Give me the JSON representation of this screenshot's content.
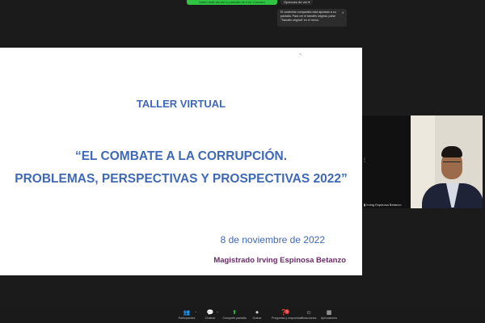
{
  "banner": {
    "share_text": "Usted está viendo la pantalla de Irvin Corrarra",
    "view_options": "Opciones de ver ▾"
  },
  "tooltip": {
    "line1": "El contenido compartido está ajustado a su",
    "line2": "pantalla. Para ver el tamaño original, pulse",
    "line3": "\"Tamaño original\" en el menú.",
    "close": "✕"
  },
  "slide": {
    "title": "TALLER VIRTUAL",
    "subtitle_line1": "“EL COMBATE A LA CORRUPCIÓN.",
    "subtitle_line2": "PROBLEMAS, PERSPECTIVAS Y PROSPECTIVAS 2022”",
    "date": "8 de noviembre de 2022",
    "author": "Magistrado Irving Espinosa Betanzo"
  },
  "participant": {
    "name": "Irving Espinosa Betanzo",
    "grip_icon": "⋮"
  },
  "toolbar": {
    "items": [
      {
        "icon": "people-icon",
        "glyph": "👥",
        "label": "Participantes"
      },
      {
        "icon": "chat-icon",
        "glyph": "💬",
        "label": "Chatear"
      },
      {
        "icon": "share-screen-icon",
        "glyph": "⬆",
        "label": "Compartir pantalla"
      },
      {
        "icon": "record-icon",
        "glyph": "⏺",
        "label": "Grabar"
      },
      {
        "icon": "qa-icon",
        "glyph": "❓",
        "label": "Preguntas y respuestas"
      },
      {
        "icon": "reactions-icon",
        "glyph": "☺",
        "label": "Reacciones"
      },
      {
        "icon": "apps-icon",
        "glyph": "▦",
        "label": "Aplicaciones"
      }
    ],
    "badge_count": "1",
    "caret": "^"
  }
}
